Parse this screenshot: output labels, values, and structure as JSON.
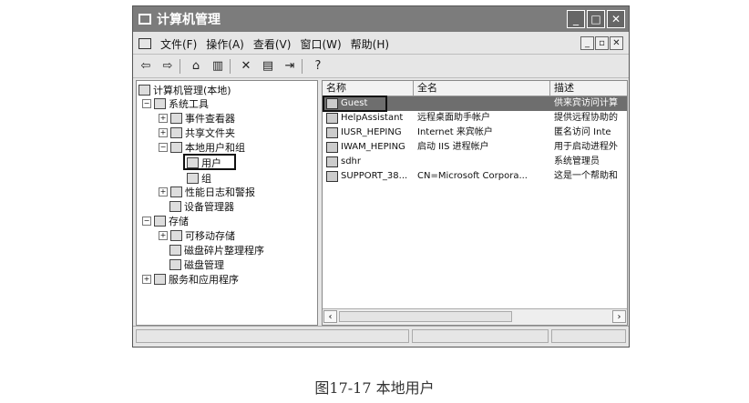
{
  "window": {
    "title": "计算机管理"
  },
  "menubar": {
    "items": [
      "文件(F)",
      "操作(A)",
      "查看(V)",
      "窗口(W)",
      "帮助(H)"
    ]
  },
  "toolbar": {
    "icons": [
      "back-arrow-icon",
      "forward-arrow-icon",
      "up-folder-icon",
      "show-tree-icon",
      "delete-icon",
      "properties-icon",
      "export-icon",
      "help-icon"
    ]
  },
  "tree": {
    "root": "计算机管理(本地)",
    "system_tools": "系统工具",
    "event_viewer": "事件查看器",
    "shared_folders": "共享文件夹",
    "local_users": "本地用户和组",
    "users": "用户",
    "groups": "组",
    "perf_logs": "性能日志和警报",
    "device_manager": "设备管理器",
    "storage": "存储",
    "removable_storage": "可移动存储",
    "defrag": "磁盘碎片整理程序",
    "disk_management": "磁盘管理",
    "services_apps": "服务和应用程序"
  },
  "list": {
    "columns": [
      "名称",
      "全名",
      "描述"
    ],
    "rows": [
      {
        "name": "Guest",
        "fullname": "",
        "desc": "供来宾访问计算",
        "selected": true
      },
      {
        "name": "HelpAssistant",
        "fullname": "远程桌面助手帐户",
        "desc": "提供远程协助的"
      },
      {
        "name": "IUSR_HEPING",
        "fullname": "Internet 来宾帐户",
        "desc": "匿名访问 Inte"
      },
      {
        "name": "IWAM_HEPING",
        "fullname": "启动 IIS 进程帐户",
        "desc": "用于启动进程外"
      },
      {
        "name": "sdhr",
        "fullname": "",
        "desc": "系统管理员"
      },
      {
        "name": "SUPPORT_38...",
        "fullname": "CN=Microsoft Corpora...",
        "desc": "这是一个帮助和"
      }
    ]
  },
  "caption": "图17-17  本地用户"
}
